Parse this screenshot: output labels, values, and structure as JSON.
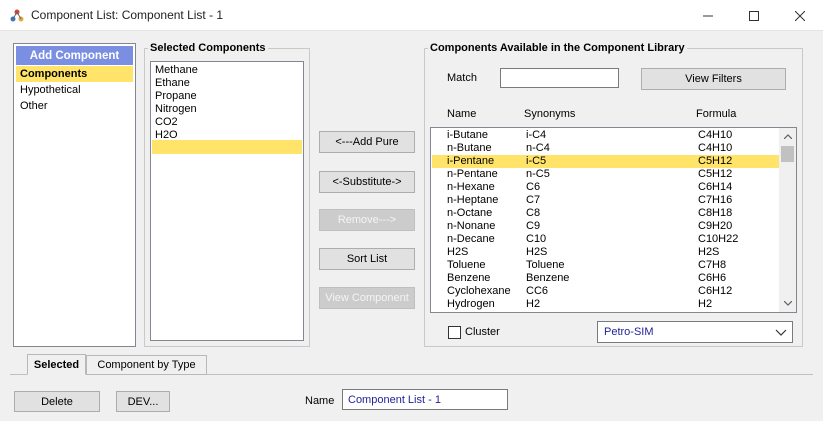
{
  "window": {
    "title": "Component List: Component List - 1"
  },
  "left_panel": {
    "header": "Add Component",
    "items": [
      {
        "label": "Components",
        "selected": true
      },
      {
        "label": "Hypothetical",
        "selected": false
      },
      {
        "label": "Other",
        "selected": false
      }
    ]
  },
  "selected_components": {
    "title": "Selected Components",
    "items": [
      "Methane",
      "Ethane",
      "Propane",
      "Nitrogen",
      "CO2",
      "H2O"
    ]
  },
  "actions": {
    "add_pure": "<---Add Pure",
    "substitute": "<-Substitute->",
    "remove": "Remove--->",
    "sort_list": "Sort List",
    "view_component": "View Component"
  },
  "library": {
    "title": "Components Available in the Component Library",
    "match_label": "Match",
    "match_value": "",
    "view_filters": "View Filters",
    "columns": {
      "name": "Name",
      "synonyms": "Synonyms",
      "formula": "Formula"
    },
    "rows": [
      {
        "name": "i-Butane",
        "synonym": "i-C4",
        "formula": "C4H10"
      },
      {
        "name": "n-Butane",
        "synonym": "n-C4",
        "formula": "C4H10"
      },
      {
        "name": "i-Pentane",
        "synonym": "i-C5",
        "formula": "C5H12"
      },
      {
        "name": "n-Pentane",
        "synonym": "n-C5",
        "formula": "C5H12"
      },
      {
        "name": "n-Hexane",
        "synonym": "C6",
        "formula": "C6H14"
      },
      {
        "name": "n-Heptane",
        "synonym": "C7",
        "formula": "C7H16"
      },
      {
        "name": "n-Octane",
        "synonym": "C8",
        "formula": "C8H18"
      },
      {
        "name": "n-Nonane",
        "synonym": "C9",
        "formula": "C9H20"
      },
      {
        "name": "n-Decane",
        "synonym": "C10",
        "formula": "C10H22"
      },
      {
        "name": "H2S",
        "synonym": "H2S",
        "formula": "H2S"
      },
      {
        "name": "Toluene",
        "synonym": "Toluene",
        "formula": "C7H8"
      },
      {
        "name": "Benzene",
        "synonym": "Benzene",
        "formula": "C6H6"
      },
      {
        "name": "Cyclohexane",
        "synonym": "CC6",
        "formula": "C6H12"
      },
      {
        "name": "Hydrogen",
        "synonym": "H2",
        "formula": "H2"
      }
    ],
    "cluster_label": "Cluster",
    "package": "Petro-SIM"
  },
  "tabs": [
    {
      "label": "Selected",
      "active": true
    },
    {
      "label": "Component by Type",
      "active": false
    }
  ],
  "footer": {
    "delete": "Delete",
    "dev": "DEV...",
    "name_label": "Name",
    "name_value": "Component List - 1"
  },
  "colors": {
    "selection": "#ffe469",
    "header_blue": "#7b8fe2",
    "value_text": "#1f1f9a"
  }
}
